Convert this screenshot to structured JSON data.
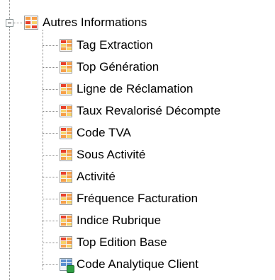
{
  "tree": {
    "root": {
      "label": "Autres Informations",
      "icon": "table-group-icon",
      "expanded": true
    },
    "children": [
      {
        "label": "Tag Extraction",
        "icon": "table-icon"
      },
      {
        "label": "Top Génération",
        "icon": "table-icon"
      },
      {
        "label": "Ligne de Réclamation",
        "icon": "table-icon"
      },
      {
        "label": "Taux Revalorisé Décompte",
        "icon": "table-icon"
      },
      {
        "label": "Code TVA",
        "icon": "table-icon"
      },
      {
        "label": "Sous Activité",
        "icon": "table-icon"
      },
      {
        "label": "Activité",
        "icon": "table-icon"
      },
      {
        "label": "Fréquence Facturation",
        "icon": "table-icon"
      },
      {
        "label": "Indice Rubrique",
        "icon": "table-icon"
      },
      {
        "label": "Top Edition Base",
        "icon": "table-icon"
      },
      {
        "label": "Code Analytique Client",
        "icon": "view-icon"
      }
    ]
  }
}
